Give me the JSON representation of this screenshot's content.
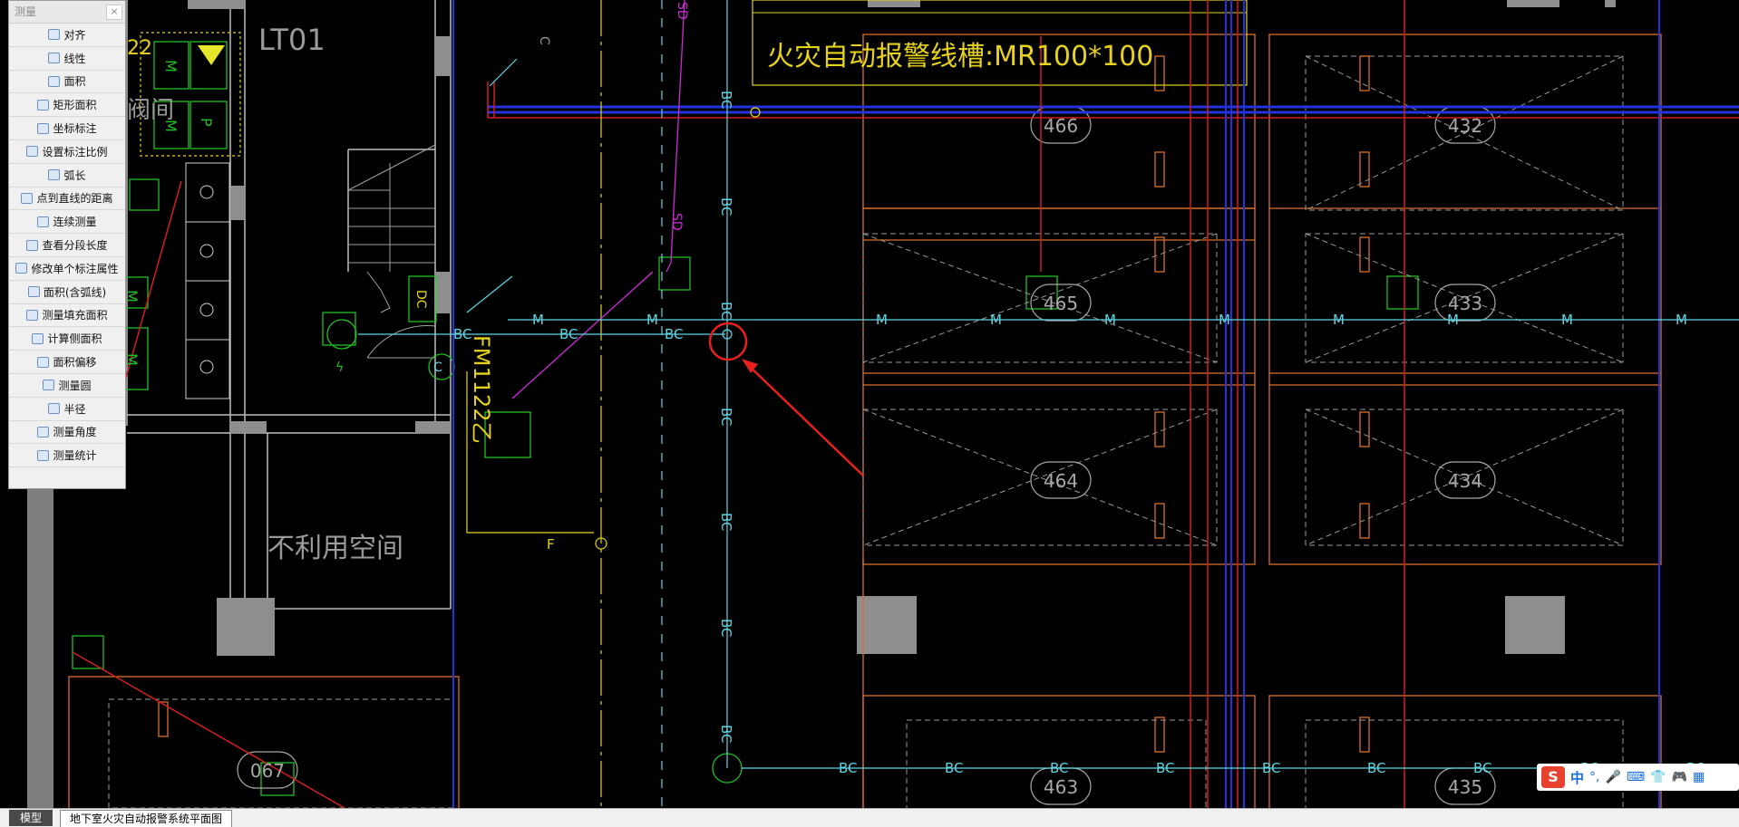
{
  "palette": {
    "title": "测量",
    "close_label": "×",
    "items": [
      {
        "label": "对齐"
      },
      {
        "label": "线性"
      },
      {
        "label": "面积"
      },
      {
        "label": "矩形面积"
      },
      {
        "label": "坐标标注"
      },
      {
        "label": "设置标注比例"
      },
      {
        "label": "弧长"
      },
      {
        "label": "点到直线的距离"
      },
      {
        "label": "连续测量"
      },
      {
        "label": "查看分段长度"
      },
      {
        "label": "修改单个标注属性"
      },
      {
        "label": "面积(含弧线)"
      },
      {
        "label": "测量填充面积"
      },
      {
        "label": "计算侧面积"
      },
      {
        "label": "面积偏移"
      },
      {
        "label": "测量圆"
      },
      {
        "label": "半径"
      },
      {
        "label": "测量角度"
      },
      {
        "label": "测量统计"
      }
    ]
  },
  "drawing": {
    "cable_tray_label": "火灾自动报警线槽:MR100*100",
    "stair_label": "LT01",
    "unused_space_label": "不利用空间",
    "valve_room_label": "阀间",
    "room_numbers": [
      "466",
      "432",
      "465",
      "433",
      "464",
      "434",
      "463",
      "435",
      "067"
    ],
    "line_tag_bc": "BC",
    "line_tag_m": "M",
    "line_tag_f": "F",
    "line_tag_sd": "SD",
    "line_tag_c": "C",
    "door_label": "FM1122乙",
    "panel_label_dc": "DC",
    "device_m": "M",
    "device_p": "P",
    "left_label_22": "22"
  },
  "statusbar": {
    "tab_model": "模型",
    "tab_layout": "地下室火灾自动报警系统平面图"
  },
  "ime": {
    "logo": "S",
    "lang": "中",
    "glyphs": [
      "°,",
      "🎤",
      "⌨",
      "👕",
      "🎮",
      "▦"
    ]
  },
  "colors": {
    "background": "#000000",
    "cyan": "#5ed7e6",
    "yellow": "#e6d21e",
    "orange": "#d9702a",
    "red": "#d21e1e",
    "blue": "#2233dd",
    "green": "#21c021",
    "magenta": "#cf2bd6",
    "gray": "#a0a0a0"
  }
}
